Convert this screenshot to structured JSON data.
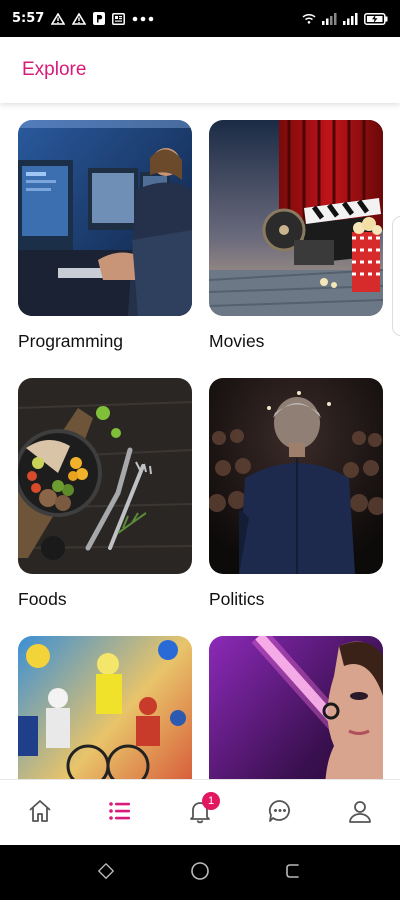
{
  "status_bar": {
    "time": "5:57"
  },
  "header": {
    "title": "Explore"
  },
  "categories": [
    {
      "label": "Programming"
    },
    {
      "label": "Movies"
    },
    {
      "label": "Foods"
    },
    {
      "label": "Politics"
    },
    {
      "label": ""
    },
    {
      "label": ""
    }
  ],
  "bottom_nav": {
    "items": [
      {
        "icon": "home-icon"
      },
      {
        "icon": "list-icon"
      },
      {
        "icon": "bell-icon",
        "badge": "1"
      },
      {
        "icon": "chat-icon"
      },
      {
        "icon": "profile-icon"
      }
    ],
    "active_index": 1,
    "accent": "#d81b7a"
  },
  "colors": {
    "accent": "#d81b7a",
    "badge": "#e1175f"
  }
}
